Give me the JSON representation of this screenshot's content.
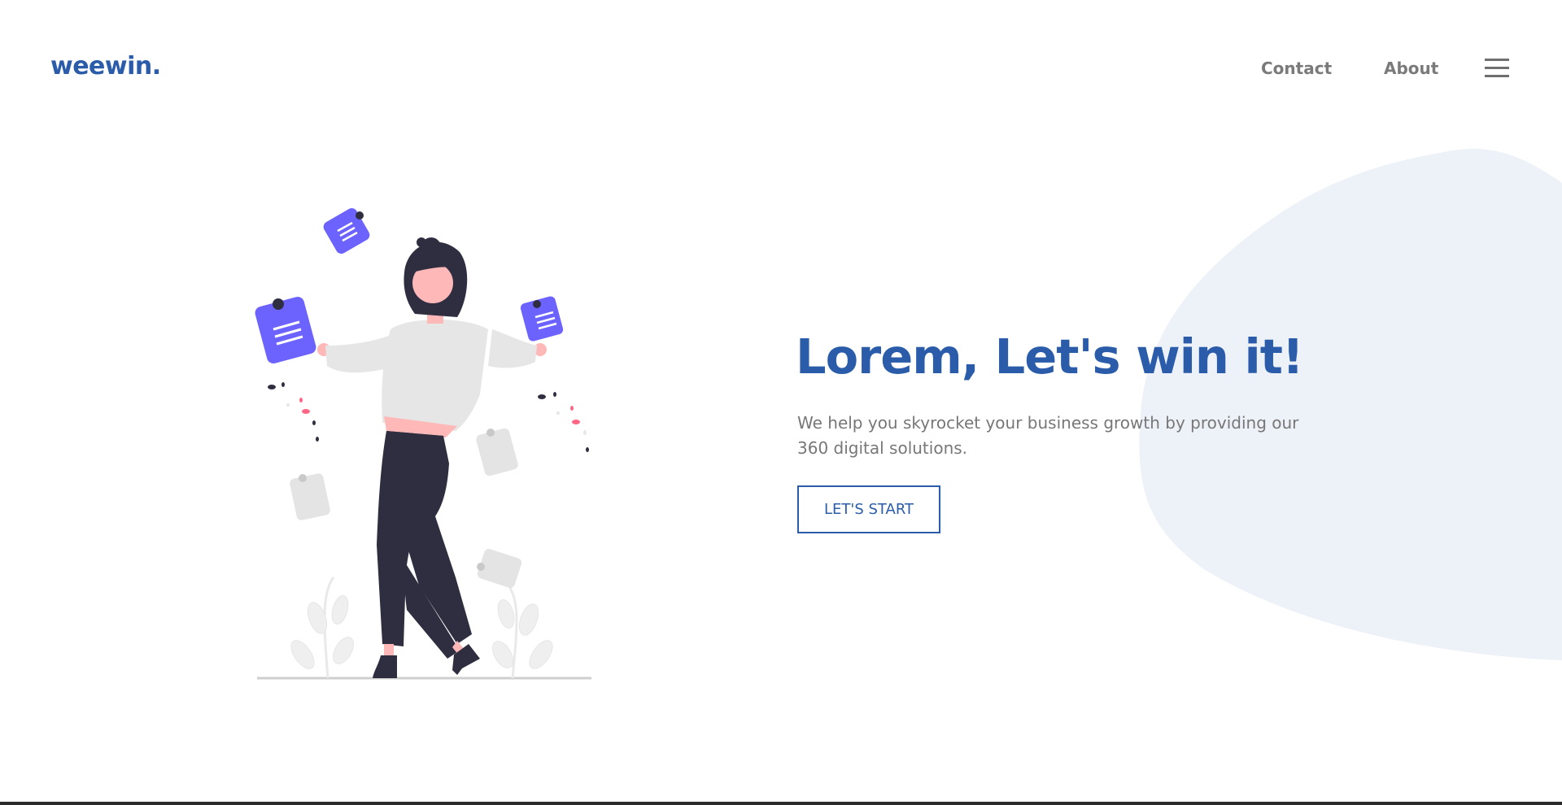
{
  "header": {
    "logo": "weewin.",
    "nav": [
      {
        "label": "Contact"
      },
      {
        "label": "About"
      }
    ],
    "menu_icon": "hamburger-menu-icon"
  },
  "hero": {
    "title": "Lorem, Let's win it!",
    "subtitle": "We help you skyrocket your business growth by providing our 360 digital solutions.",
    "cta_label": "LET'S START",
    "illustration": "woman-juggling-documents-illustration"
  },
  "colors": {
    "brand": "#2a5caa",
    "nav_text": "#7a7a7a",
    "body_text": "#777777",
    "blob": "#edf1f8",
    "accent_purple": "#6c63ff"
  }
}
